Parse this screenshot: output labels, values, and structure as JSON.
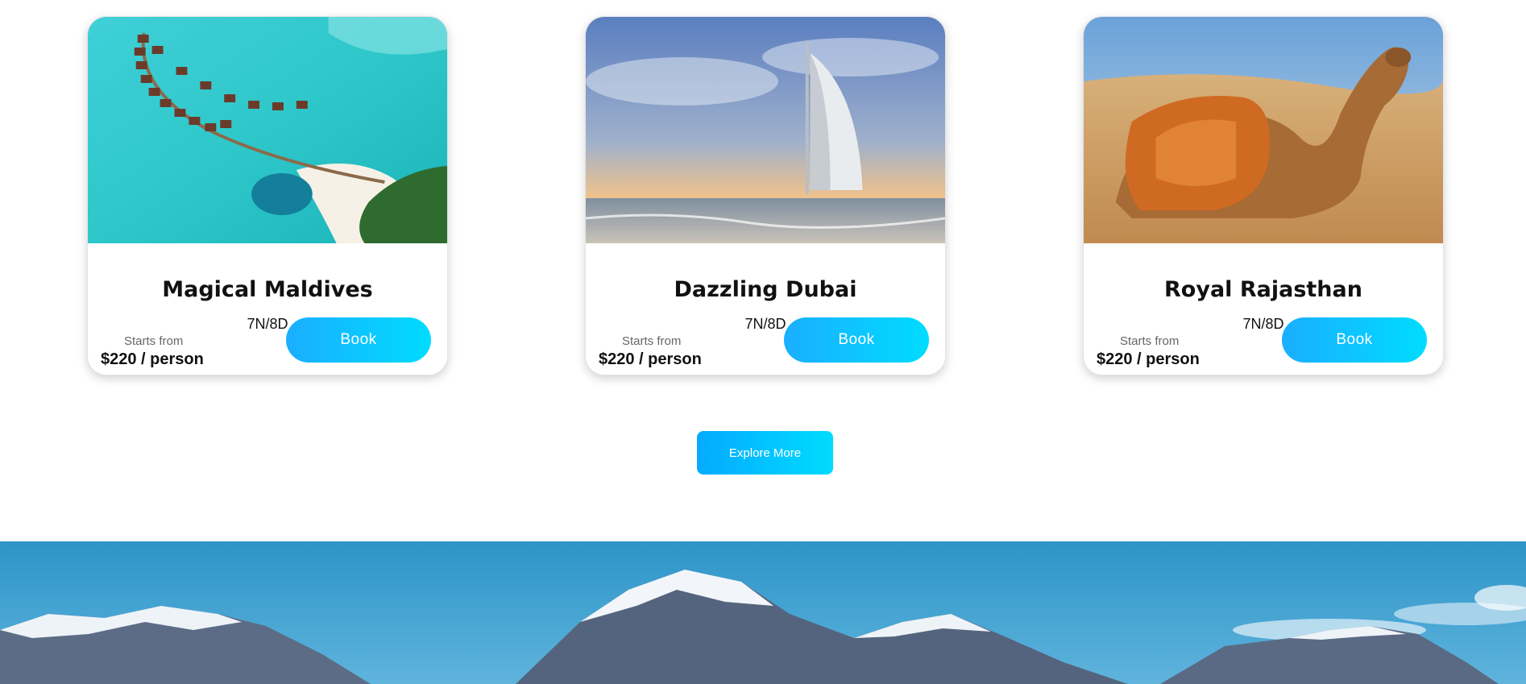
{
  "cards": [
    {
      "title": "Magical Maldives",
      "duration": "7N/8D",
      "starts_label": "Starts from",
      "price": "$220 / person",
      "book_label": "Book",
      "image": "maldives-overwater-villas"
    },
    {
      "title": "Dazzling Dubai",
      "duration": "7N/8D",
      "starts_label": "Starts from",
      "price": "$220 / person",
      "book_label": "Book",
      "image": "burj-al-arab-beach"
    },
    {
      "title": "Royal Rajasthan",
      "duration": "7N/8D",
      "starts_label": "Starts from",
      "price": "$220 / person",
      "book_label": "Book",
      "image": "desert-camel"
    }
  ],
  "explore_label": "Explore More",
  "banner_image": "snowy-mountains",
  "colors": {
    "button_start": "#1aaeff",
    "button_end": "#00dcff"
  }
}
